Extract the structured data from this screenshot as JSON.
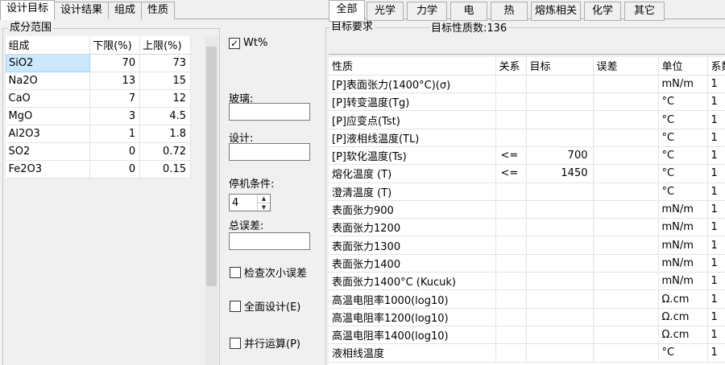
{
  "main_tabs": [
    "设计目标",
    "设计结果",
    "组成",
    "性质"
  ],
  "composition": {
    "group_title": "成分范围",
    "headers": [
      "组成",
      "下限(%)",
      "上限(%)"
    ],
    "rows": [
      [
        "SiO2",
        "70",
        "73"
      ],
      [
        "Na2O",
        "13",
        "15"
      ],
      [
        "CaO",
        "7",
        "12"
      ],
      [
        "MgO",
        "3",
        "4.5"
      ],
      [
        "Al2O3",
        "1",
        "1.8"
      ],
      [
        "SO2",
        "0",
        "0.72"
      ],
      [
        "Fe2O3",
        "0",
        "0.15"
      ]
    ]
  },
  "controls": {
    "wt_label": "Wt%",
    "wt_checked": "✓",
    "glass_label": "玻璃:",
    "design_label": "设计:",
    "stop_label": "停机条件:",
    "stop_value": "4",
    "total_error_label": "总误差:",
    "check_min_error": "检查次小误差",
    "full_design": "全面设计(E)",
    "parallel": "并行运算(P)"
  },
  "requirements": {
    "group_title": "目标要求",
    "count_label": "目标性质数:136",
    "tabs": [
      "全部",
      "光学",
      "力学",
      "电",
      "热",
      "熔炼相关",
      "化学",
      "其它"
    ],
    "headers": [
      "性质",
      "关系",
      "目标",
      "误差",
      "单位",
      "系数"
    ],
    "rows": [
      [
        "[P]表面张力(1400°C)(σ)",
        "",
        "",
        "",
        "mN/m",
        "1"
      ],
      [
        "[P]转变温度(Tg)",
        "",
        "",
        "",
        "°C",
        "1"
      ],
      [
        "[P]应变点(Tst)",
        "",
        "",
        "",
        "°C",
        "1"
      ],
      [
        "[P]液相线温度(TL)",
        "",
        "",
        "",
        "°C",
        "1"
      ],
      [
        "[P]软化温度(Ts)",
        "<=",
        "700",
        "",
        "°C",
        "1"
      ],
      [
        "熔化温度 (T)",
        "<=",
        "1450",
        "",
        "°C",
        "1"
      ],
      [
        "澄清温度 (T)",
        "",
        "",
        "",
        "°C",
        "1"
      ],
      [
        "表面张力900",
        "",
        "",
        "",
        "mN/m",
        "1"
      ],
      [
        "表面张力1200",
        "",
        "",
        "",
        "mN/m",
        "1"
      ],
      [
        "表面张力1300",
        "",
        "",
        "",
        "mN/m",
        "1"
      ],
      [
        "表面张力1400",
        "",
        "",
        "",
        "mN/m",
        "1"
      ],
      [
        "表面张力1400°C (Kucuk)",
        "",
        "",
        "",
        "mN/m",
        "1"
      ],
      [
        "高温电阻率1000(log10)",
        "",
        "",
        "",
        "Ω.cm",
        "1"
      ],
      [
        "高温电阻率1200(log10)",
        "",
        "",
        "",
        "Ω.cm",
        "1"
      ],
      [
        "高温电阻率1400(log10)",
        "",
        "",
        "",
        "Ω.cm",
        "1"
      ],
      [
        "液相线温度",
        "",
        "",
        "",
        "°C",
        "1"
      ]
    ]
  },
  "colors": {
    "selection": "#cce8ff",
    "background": "#f0f0f0"
  }
}
